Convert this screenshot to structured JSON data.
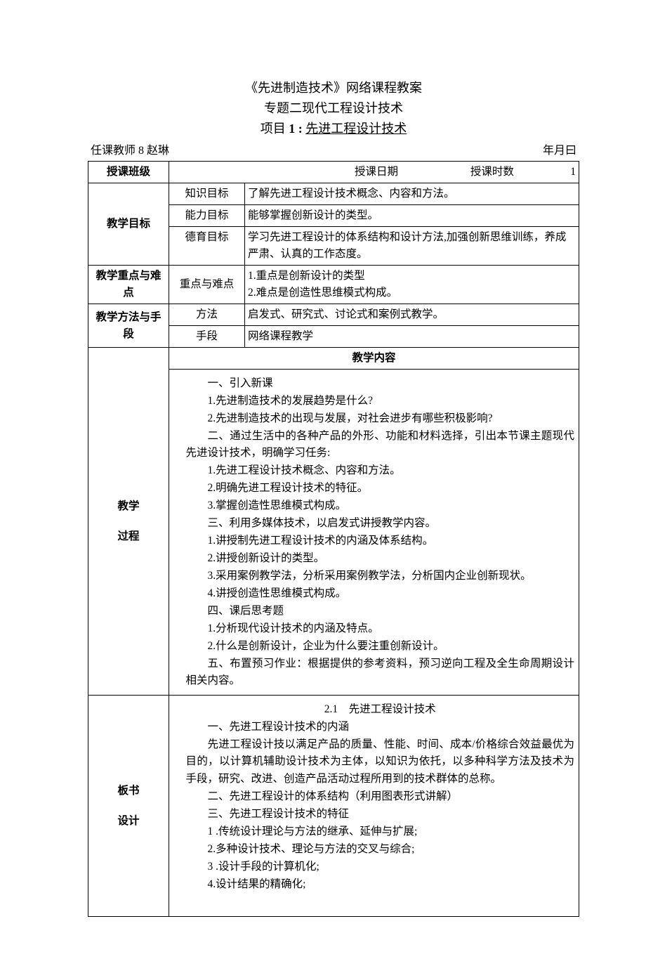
{
  "title": {
    "line1": "《先进制造技术》网络课程教案",
    "line2": "专题二现代工程设计技术",
    "project_prefix": "项目 ",
    "project_num": "1 : ",
    "project_name": "先进工程设计技术"
  },
  "meta": {
    "teacher_label": "任课教师 8 赵琳",
    "date_label": "年月曰"
  },
  "row_class": {
    "label": "授课班级",
    "date_label": "授课日期",
    "hours_label": "授课时数",
    "hours_value": "1"
  },
  "goals": {
    "group_label": "教学目标",
    "knowledge_label": "知识目标",
    "knowledge_text": "了解先进工程设计技术概念、内容和方法。",
    "ability_label": "能力目标",
    "ability_text": "能够掌握创新设计的类型。",
    "moral_label": "德育目标",
    "moral_text": "学习先进工程设计的体系结构和设计方法,加强创新思维训练，养成严肃、认真的工作态度。"
  },
  "keydiff": {
    "group_label": "教学重点与难点",
    "sub_label": "重点与难点",
    "line1": "1.重点是创新设计的类型",
    "line2": "2.难点是创造性思维模式构成。"
  },
  "method": {
    "group_label": "教学方法与手段",
    "method_label": "方法",
    "method_text": "启发式、研究式、讨论式和案例式教学。",
    "means_label": "手段",
    "means_text": "网络课程教学"
  },
  "process": {
    "header": "教学内容",
    "group_label_line1": "教学",
    "group_label_line2": "过程",
    "lines": [
      "一、引入新课",
      "1.先进制造技术的发展趋势是什么?",
      "2.先进制造技术的出现与发展，对社会进步有哪些积极影响?",
      "二、通过生活中的各种产品的外形、功能和材料选择，引出本节课主题现代先进设计技术，明确学习任务:",
      "1.先进工程设计技术概念、内容和方法。",
      "2.明确先进工程设计技术的特征。",
      "3.掌握创造性思维模式构成。",
      "三、利用多媒体技术，以启发式讲授教学内容。",
      "1.讲授制先进工程设计技术的内涵及体系结构。",
      "2.讲授创新设计的类型。",
      "3.采用案例教学法，分析采用案例教学法，分析国内企业创新现状。",
      "4.讲授创造性思维模式构成。",
      "四、课后思考题",
      "1.分析现代设计技术的内涵及特点。",
      "2.什么是创新设计，企业为什么要注重创新设计。",
      "五、布置预习作业：根据提供的参考资料，预习逆向工程及全生命周期设计相关内容。"
    ]
  },
  "board": {
    "group_label_line1": "板书",
    "group_label_line2": "设计",
    "section_title": "2.1　先进工程设计技术",
    "lines": [
      "一、先进工程设计技术的内涵",
      "先进工程设计技以满足产品的质量、性能、时间、成本/价格综合效益最优为目的，以计算机辅助设计技术为主体，以知识为依托，以多种科学方法及技术为手段，研究、改进、创造产品活动过程所用到的技术群体的总称。",
      "二、先进工程设计的体系结构（利用图表形式讲解）",
      "三、先进工程设计技术的特征",
      "1 .传统设计理论与方法的继承、延伸与扩展;",
      "2.多种设计技术、理论与方法的交叉与综合;",
      "3 .设计手段的计算机化;",
      "4.设计结果的精确化;"
    ]
  }
}
